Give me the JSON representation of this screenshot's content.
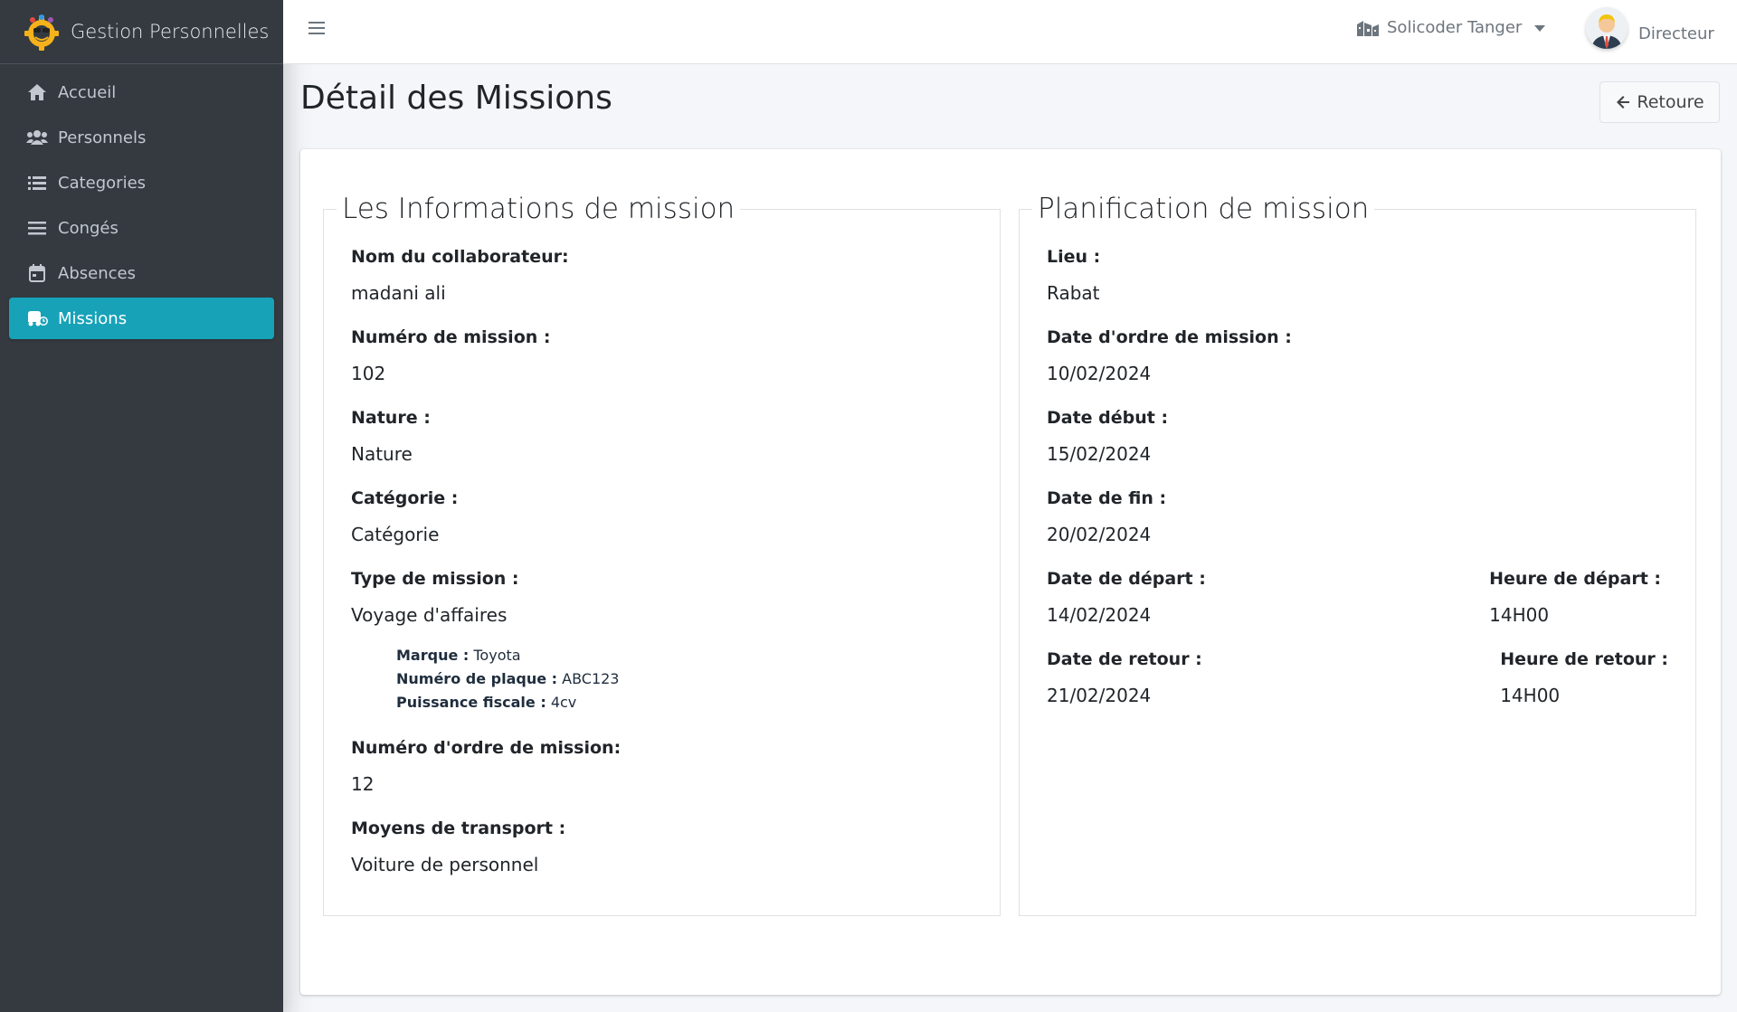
{
  "brand": {
    "title": "Gestion Personnelles"
  },
  "sidebar": {
    "items": [
      {
        "label": "Accueil",
        "icon": "home-icon"
      },
      {
        "label": "Personnels",
        "icon": "users-icon"
      },
      {
        "label": "Categories",
        "icon": "list-icon"
      },
      {
        "label": "Congés",
        "icon": "bars-icon"
      },
      {
        "label": "Absences",
        "icon": "calendar-icon"
      },
      {
        "label": "Missions",
        "icon": "car-icon",
        "active": true
      }
    ]
  },
  "topbar": {
    "company": "Solicoder Tanger",
    "user": "Directeur"
  },
  "page": {
    "title": "Détail des Missions",
    "back_label": "Retoure"
  },
  "info": {
    "legend": "Les Informations de mission",
    "collaborateur_label": "Nom du collaborateur:",
    "collaborateur": "madani ali",
    "numero_label": "Numéro de mission :",
    "numero": "102",
    "nature_label": "Nature :",
    "nature": "Nature",
    "categorie_label": "Catégorie :",
    "categorie": "Catégorie",
    "type_label": "Type de mission :",
    "type": "Voyage d'affaires",
    "vehicle": {
      "marque_label": "Marque :",
      "marque": "Toyota",
      "plaque_label": "Numéro de plaque :",
      "plaque": "ABC123",
      "puissance_label": "Puissance fiscale :",
      "puissance": "4cv"
    },
    "ordre_label": "Numéro d'ordre de mission:",
    "ordre": "12",
    "transport_label": "Moyens de transport :",
    "transport": "Voiture de personnel"
  },
  "plan": {
    "legend": "Planification de mission",
    "lieu_label": "Lieu :",
    "lieu": "Rabat",
    "date_ordre_label": "Date d'ordre de mission :",
    "date_ordre": "10/02/2024",
    "date_debut_label": "Date début :",
    "date_debut": "15/02/2024",
    "date_fin_label": "Date de fin :",
    "date_fin": "20/02/2024",
    "date_depart_label": "Date de départ :",
    "date_depart": "14/02/2024",
    "heure_depart_label": "Heure de départ :",
    "heure_depart": "14H00",
    "date_retour_label": "Date de retour :",
    "date_retour": "21/02/2024",
    "heure_retour_label": "Heure de retour :",
    "heure_retour": "14H00"
  },
  "colors": {
    "sidebar_bg": "#343a40",
    "active": "#17a2b8"
  }
}
